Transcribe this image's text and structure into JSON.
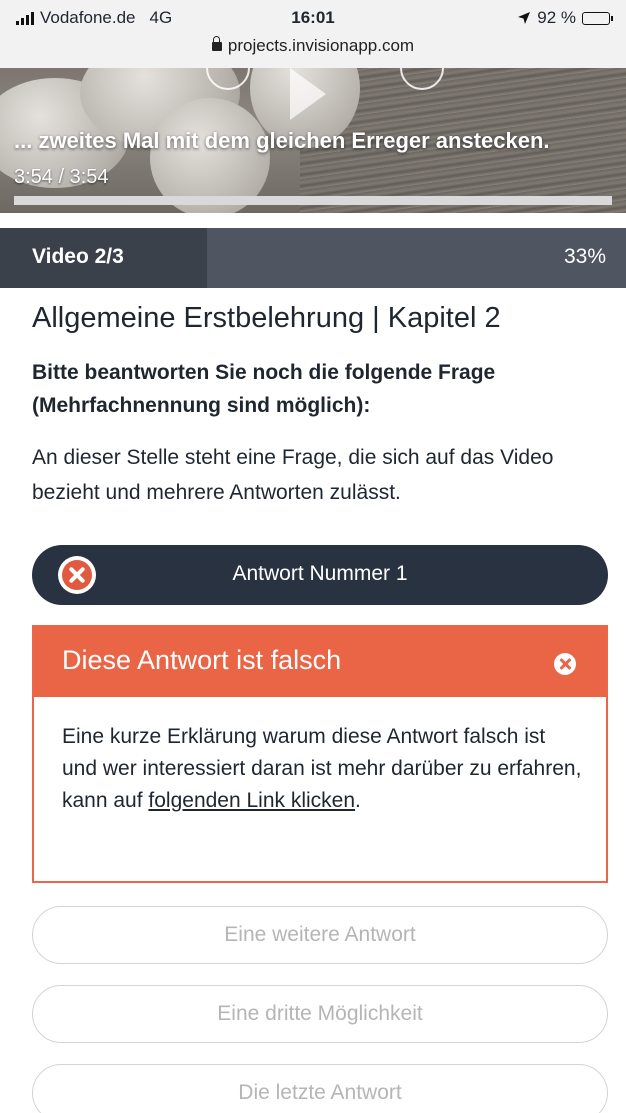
{
  "status_bar": {
    "carrier": "Vodafone.de",
    "network": "4G",
    "time": "16:01",
    "battery": "92 %",
    "url": "projects.invisionapp.com"
  },
  "video": {
    "subtitle": "... zweites Mal mit dem gleichen Erreger anstecken.",
    "timecode": "3:54 / 3:54",
    "progress_fraction": 1.0
  },
  "progress": {
    "label": "Video 2/3",
    "percent": "33%",
    "fraction": 0.33
  },
  "content": {
    "chapter_title": "Allgemeine Erstbelehrung | Kapitel 2",
    "question_intro": "Bitte beantworten Sie noch die folgende Frage (Mehrfachnennung sind möglich):",
    "question_text": "An dieser Stelle steht eine Frage, die sich auf das Video bezieht und mehrere Antworten zulässt."
  },
  "selected_answer": {
    "label": "Antwort Nummer 1",
    "icon": "x-circle-icon"
  },
  "feedback": {
    "title": "Diese Antwort ist falsch",
    "body_text": "Eine kurze Erklärung warum diese Antwort falsch ist und wer interessiert daran ist mehr darüber zu erfahren, kann auf ",
    "link_text": "folgenden Link klicken",
    "body_end": ".",
    "color": "#ea6446"
  },
  "answers": [
    {
      "label": "Eine weitere Antwort"
    },
    {
      "label": "Eine dritte Möglichkeit"
    },
    {
      "label": "Die letzte Antwort"
    }
  ],
  "colors": {
    "dark": "#283240",
    "progress_bg": "#4f5661",
    "error": "#ea6446"
  }
}
